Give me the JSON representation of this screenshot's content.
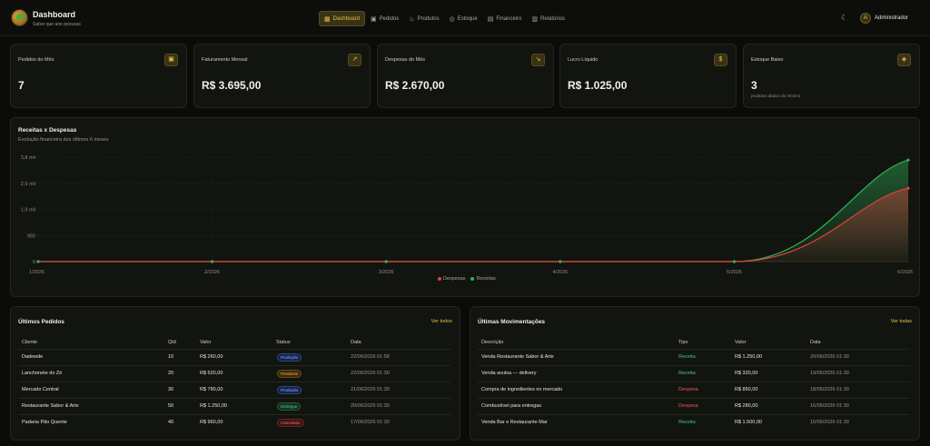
{
  "header": {
    "title": "Dashboard",
    "subtitle": "Sabor que une pessoas",
    "nav": [
      {
        "label": "Dashboard",
        "icon": "dashboard-icon",
        "active": true
      },
      {
        "label": "Pedidos",
        "icon": "clipboard-icon"
      },
      {
        "label": "Produtos",
        "icon": "chef-hat-icon"
      },
      {
        "label": "Estoque",
        "icon": "box-icon"
      },
      {
        "label": "Financeiro",
        "icon": "calendar-icon"
      },
      {
        "label": "Relatórios",
        "icon": "bar-chart-icon"
      }
    ],
    "user": "Administrador",
    "user_initial": "A"
  },
  "cards": [
    {
      "title": "Pedidos do Mês",
      "value": "7",
      "icon": "calendar-icon",
      "note": ""
    },
    {
      "title": "Faturamento Mensal",
      "value": "R$ 3.695,00",
      "icon": "trend-up-icon",
      "note": ""
    },
    {
      "title": "Despesas do Mês",
      "value": "R$ 2.670,00",
      "icon": "trend-down-icon",
      "note": ""
    },
    {
      "title": "Lucro Líquido",
      "value": "R$ 1.025,00",
      "icon": "dollar-icon",
      "note": ""
    },
    {
      "title": "Estoque Baixo",
      "value": "3",
      "icon": "package-icon",
      "note": "produtos abaixo do mínimo"
    }
  ],
  "chart": {
    "title": "Receitas x Despesas",
    "subtitle": "Evolução financeira dos últimos 6 meses"
  },
  "chart_data": {
    "type": "area",
    "title": "Receitas x Despesas",
    "subtitle": "Evolução financeira dos últimos 6 meses",
    "x": [
      "1/2026",
      "2/2026",
      "3/2026",
      "4/2026",
      "5/2026",
      "6/2026"
    ],
    "ylim": [
      0,
      3800
    ],
    "yticks": [
      0,
      950,
      1900,
      2850,
      3800
    ],
    "ytick_labels": [
      "0",
      "950",
      "1,9 mil",
      "2,9 mil",
      "3,8 mil"
    ],
    "series": [
      {
        "name": "Despesas",
        "values": [
          0,
          0,
          0,
          0,
          0,
          2670
        ],
        "color": "#e0413f"
      },
      {
        "name": "Receitas",
        "values": [
          0,
          0,
          0,
          0,
          0,
          3695
        ],
        "color": "#2fb457"
      }
    ],
    "legend": "bottom",
    "grid": true
  },
  "orders": {
    "title": "Últimos Pedidos",
    "link": "Ver todos",
    "headers": [
      "Cliente",
      "Qtd",
      "Valor",
      "Status",
      "Data"
    ],
    "rows": [
      {
        "cliente": "Dadewde",
        "qtd": "10",
        "valor": "R$ 260,00",
        "status": "Produção",
        "kind": "prod",
        "data": "22/06/2026 01:58"
      },
      {
        "cliente": "Lanchonete do Zé",
        "qtd": "20",
        "valor": "R$ 520,00",
        "status": "Pendente",
        "kind": "pend",
        "data": "22/06/2026 01:30"
      },
      {
        "cliente": "Mercado Central",
        "qtd": "30",
        "valor": "R$ 780,00",
        "status": "Produção",
        "kind": "prod",
        "data": "21/06/2026 01:30"
      },
      {
        "cliente": "Restaurante Sabor & Arte",
        "qtd": "50",
        "valor": "R$ 1.250,00",
        "status": "Entregue",
        "kind": "entr",
        "data": "20/06/2026 01:30"
      },
      {
        "cliente": "Padaria Pão Quente",
        "qtd": "40",
        "valor": "R$ 960,00",
        "status": "Cancelado",
        "kind": "canc",
        "data": "17/06/2026 01:30"
      }
    ]
  },
  "movements": {
    "title": "Últimas Movimentações",
    "link": "Ver todas",
    "headers": [
      "Descrição",
      "Tipo",
      "Valor",
      "Data"
    ],
    "rows": [
      {
        "descricao": "Venda Restaurante Sabor & Arte",
        "tipo": "Receita",
        "kind": "rec",
        "valor": "R$ 1.250,00",
        "data": "20/06/2026 01:30"
      },
      {
        "descricao": "Venda avulsa — delivery",
        "tipo": "Receita",
        "kind": "rec",
        "valor": "R$ 320,00",
        "data": "19/06/2026 01:30"
      },
      {
        "descricao": "Compra de ingredientes no mercado",
        "tipo": "Despesa",
        "kind": "desp",
        "valor": "R$ 850,00",
        "data": "18/06/2026 01:30"
      },
      {
        "descricao": "Combustível para entregas",
        "tipo": "Despesa",
        "kind": "desp",
        "valor": "R$ 280,00",
        "data": "16/06/2026 01:30"
      },
      {
        "descricao": "Venda Bar e Restaurante Mar",
        "tipo": "Receita",
        "kind": "rec",
        "valor": "R$ 1.500,00",
        "data": "15/06/2026 01:30"
      }
    ]
  }
}
